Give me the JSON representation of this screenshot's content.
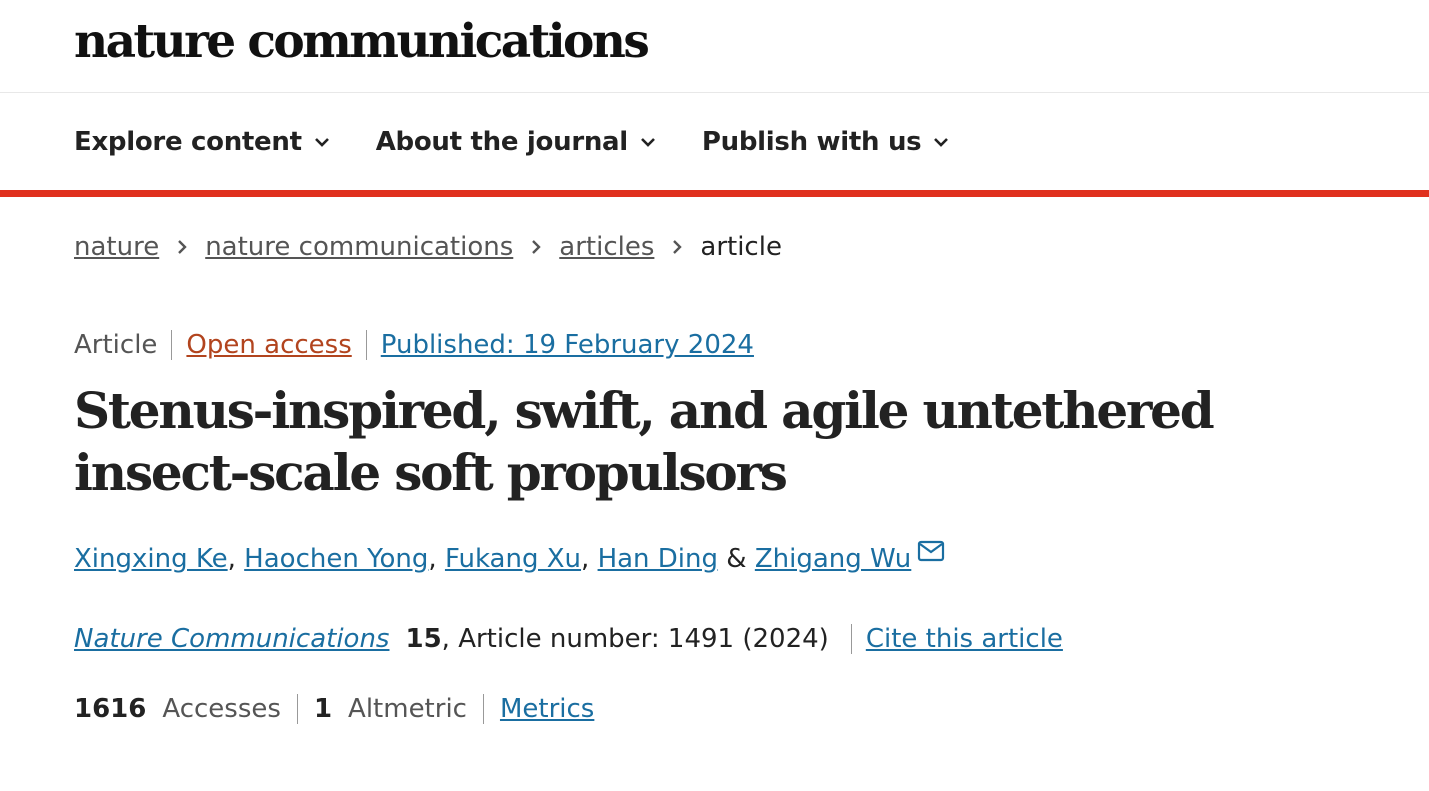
{
  "header": {
    "logo_text": "nature communications"
  },
  "nav": {
    "items": [
      {
        "label": "Explore content",
        "icon": "chevron-down-icon"
      },
      {
        "label": "About the journal",
        "icon": "chevron-down-icon"
      },
      {
        "label": "Publish with us",
        "icon": "chevron-down-icon"
      }
    ],
    "accent_color": "#e0301e"
  },
  "breadcrumb": {
    "items": [
      "nature",
      "nature communications",
      "articles"
    ],
    "current": "article"
  },
  "article": {
    "type": "Article",
    "access": "Open access",
    "published": "Published: 19 February 2024",
    "title": "Stenus-inspired, swift, and agile untethered insect-scale soft propulsors",
    "authors": [
      "Xingxing Ke",
      "Haochen Yong",
      "Fukang Xu",
      "Han Ding",
      "Zhigang Wu"
    ],
    "author_separator": ",",
    "author_conjunction": "&",
    "corresponding_icon": "mail-icon",
    "journal": "Nature Communications",
    "volume": "15",
    "article_number": ", Article number: 1491 (2024)",
    "cite_label": "Cite this article"
  },
  "metrics": {
    "accesses_count": "1616",
    "accesses_label": "Accesses",
    "altmetric_count": "1",
    "altmetric_label": "Altmetric",
    "metrics_link": "Metrics"
  },
  "colors": {
    "link": "#1a6ea1",
    "open_access": "#b2441e",
    "text": "#222222"
  }
}
